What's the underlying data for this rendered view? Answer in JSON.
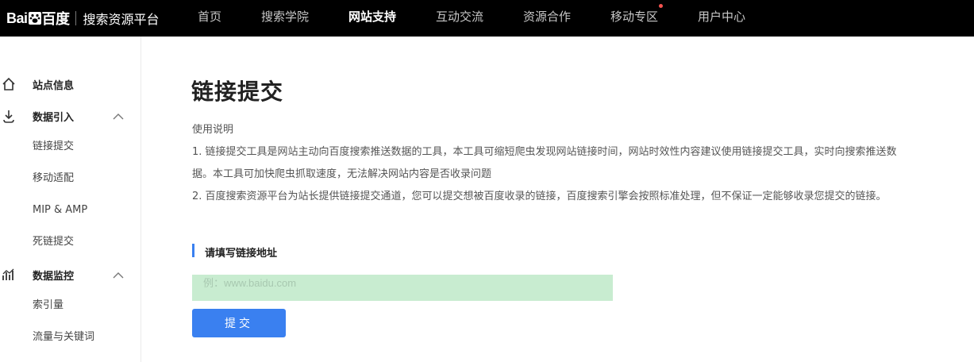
{
  "header": {
    "logo_text": "Bai",
    "logo_suffix": "百度",
    "platform_name": "搜索资源平台",
    "nav": [
      {
        "label": "首页"
      },
      {
        "label": "搜索学院"
      },
      {
        "label": "网站支持"
      },
      {
        "label": "互动交流"
      },
      {
        "label": "资源合作"
      },
      {
        "label": "移动专区"
      },
      {
        "label": "用户中心"
      }
    ]
  },
  "sidebar": {
    "site_info": "站点信息",
    "data_import": {
      "label": "数据引入",
      "items": [
        "链接提交",
        "移动适配",
        "MIP & AMP",
        "死链提交"
      ]
    },
    "data_monitor": {
      "label": "数据监控",
      "items": [
        "索引量",
        "流量与关键词"
      ]
    }
  },
  "main": {
    "title": "链接提交",
    "instructions_heading": "使用说明",
    "instruction_lines": [
      "1. 链接提交工具是网站主动向百度搜索推送数据的工具，本工具可缩短爬虫发现网站链接时间，网站时效性内容建议使用链接提交工具，实时向搜索推送数",
      "据。本工具可加快爬虫抓取速度，无法解决网站内容是否收录问题",
      "2. 百度搜索资源平台为站长提供链接提交通道，您可以提交想被百度收录的链接，百度搜索引擎会按照标准处理，但不保证一定能够收录您提交的链接。"
    ],
    "section_title": "请填写链接地址",
    "url_placeholder": "例：www.baidu.com",
    "submit_label": "提交"
  },
  "colors": {
    "accent": "#3a80f0",
    "input_bg": "#c8ecd0",
    "topbar": "#000000",
    "notice_dot": "#f5534f"
  }
}
